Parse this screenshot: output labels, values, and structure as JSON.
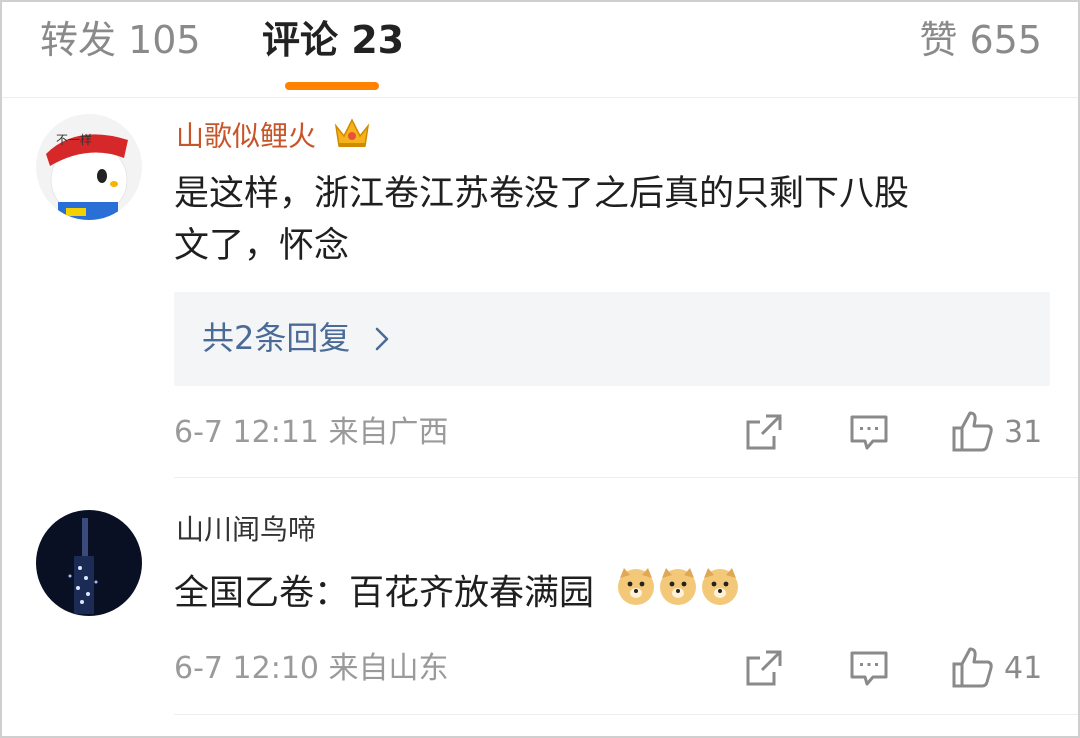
{
  "tabs": {
    "repost": "转发 105",
    "comments": "评论 23",
    "likes": "赞 655"
  },
  "colors": {
    "accent": "#ff8200",
    "link": "#4a6b96",
    "meta": "#9a9a9a"
  },
  "comments": [
    {
      "username": "山歌似鲤火",
      "badge_icon": "crown-icon",
      "text_line1": "是这样，浙江卷江苏卷没了之后真的只剩下八股",
      "text_line2": "文了，怀念",
      "reply_link": "共2条回复",
      "time_location": "6-7 12:11 来自广西",
      "likes": "31"
    },
    {
      "username": "山川闻鸟啼",
      "text": "全国乙卷：百花齐放春满园",
      "emoji_icon": "doge-icon",
      "time_location": "6-7 12:10 来自山东",
      "likes": "41"
    }
  ]
}
